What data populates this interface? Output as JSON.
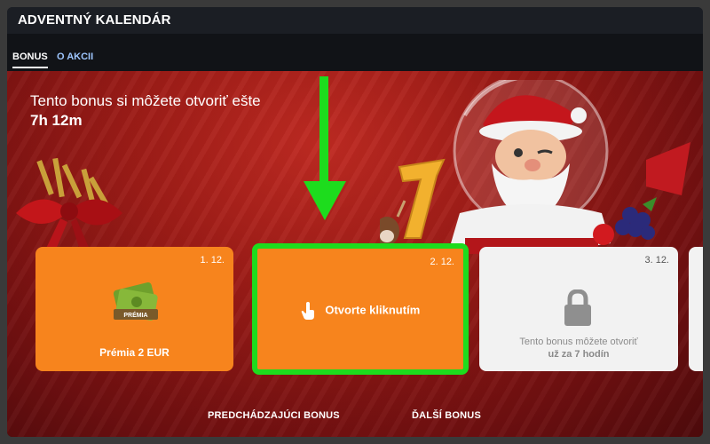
{
  "window": {
    "title": "ADVENTNÝ KALENDÁR"
  },
  "tabs": [
    {
      "label": "BONUS",
      "active": true
    },
    {
      "label": "O AKCII",
      "active": false
    }
  ],
  "banner": {
    "timer_text": "Tento bonus si môžete otvoriť ešte",
    "timer_value": "7h 12m"
  },
  "cards": [
    {
      "date": "1. 12.",
      "label": "Prémia 2 EUR",
      "icon": "money-stack-icon",
      "badge": "PRÉMIA",
      "state": "opened"
    },
    {
      "date": "2. 12.",
      "label": "Otvorte kliknutím",
      "icon": "tap-hand-icon",
      "state": "available",
      "highlight_color": "#1ddc1d"
    },
    {
      "date": "3. 12.",
      "line1": "Tento bonus môžete otvoriť",
      "line2": "už za 7 hodín",
      "icon": "lock-icon",
      "state": "locked"
    }
  ],
  "nav": {
    "prev_label": "PREDCHÁDZAJÚCI BONUS",
    "next_label": "ĎALŠÍ BONUS"
  },
  "colors": {
    "accent": "#f7841d",
    "highlight": "#1ddc1d",
    "banner": "#9d1c17"
  }
}
